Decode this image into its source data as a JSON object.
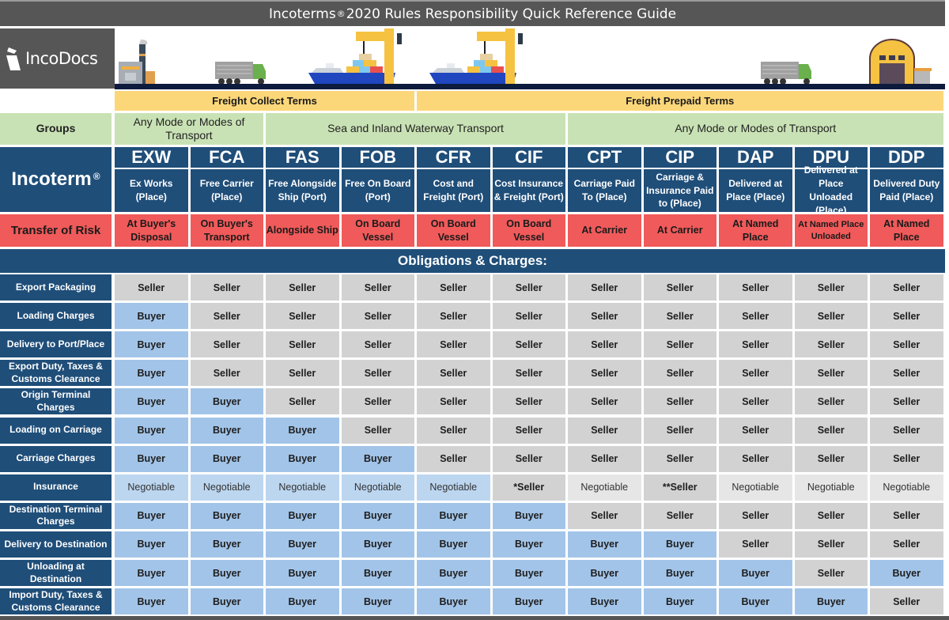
{
  "title": {
    "prefix": "Incoterms",
    "registered_mark": "®",
    "suffix": "2020 Rules Responsibility Quick Reference Guide"
  },
  "logo": {
    "text": "IncoDocs",
    "icon": "incodocs-logo-icon"
  },
  "banner_icons": [
    "factory-icon",
    "truck-icon",
    "cargo-ship-crane-icon",
    "cargo-ship-crane-icon",
    "truck-icon",
    "warehouse-icon"
  ],
  "freight_terms": [
    {
      "label": "Freight Collect Terms",
      "span": 4
    },
    {
      "label": "Freight Prepaid Terms",
      "span": 7
    }
  ],
  "groups": {
    "label": "Groups",
    "items": [
      {
        "label": "Any Mode or Modes of Transport",
        "span": 2
      },
      {
        "label": "Sea and Inland Waterway Transport",
        "span": 4
      },
      {
        "label": "Any Mode or Modes of Transport",
        "span": 5
      }
    ]
  },
  "incoterm_label": "Incoterm",
  "registered_mark": "®",
  "risk_label": "Transfer of Risk",
  "incoterms": [
    {
      "code": "EXW",
      "name": "Ex Works (Place)",
      "risk": "At Buyer's Disposal"
    },
    {
      "code": "FCA",
      "name": "Free Carrier (Place)",
      "risk": "On Buyer's Transport"
    },
    {
      "code": "FAS",
      "name": "Free Alongside Ship (Port)",
      "risk": "Alongside Ship"
    },
    {
      "code": "FOB",
      "name": "Free On Board (Port)",
      "risk": "On Board Vessel"
    },
    {
      "code": "CFR",
      "name": "Cost and Freight (Port)",
      "risk": "On Board Vessel"
    },
    {
      "code": "CIF",
      "name": "Cost Insurance & Freight (Port)",
      "risk": "On Board Vessel"
    },
    {
      "code": "CPT",
      "name": "Carriage Paid To (Place)",
      "risk": "At Carrier"
    },
    {
      "code": "CIP",
      "name": "Carriage & Insurance Paid to (Place)",
      "risk": "At Carrier"
    },
    {
      "code": "DAP",
      "name": "Delivered at Place (Place)",
      "risk": "At Named Place"
    },
    {
      "code": "DPU",
      "name": "Delivered at Place Unloaded (Place)",
      "risk": "At Named Place Unloaded"
    },
    {
      "code": "DDP",
      "name": "Delivered Duty Paid (Place)",
      "risk": "At Named Place"
    }
  ],
  "obligations_header": "Obligations & Charges:",
  "colors": {
    "navy": "#1f4e79",
    "freight_yellow": "#fcd77a",
    "group_green": "#c9e2b5",
    "risk_red": "#f05a5a",
    "seller_grey": "#d2d2d2",
    "buyer_blue": "#a2c4e8"
  },
  "obligations": [
    {
      "label": "Export Packaging",
      "values": [
        "Seller",
        "Seller",
        "Seller",
        "Seller",
        "Seller",
        "Seller",
        "Seller",
        "Seller",
        "Seller",
        "Seller",
        "Seller"
      ]
    },
    {
      "label": "Loading Charges",
      "values": [
        "Buyer",
        "Seller",
        "Seller",
        "Seller",
        "Seller",
        "Seller",
        "Seller",
        "Seller",
        "Seller",
        "Seller",
        "Seller"
      ]
    },
    {
      "label": "Delivery to Port/Place",
      "values": [
        "Buyer",
        "Seller",
        "Seller",
        "Seller",
        "Seller",
        "Seller",
        "Seller",
        "Seller",
        "Seller",
        "Seller",
        "Seller"
      ]
    },
    {
      "label": "Export Duty, Taxes & Customs Clearance",
      "values": [
        "Buyer",
        "Seller",
        "Seller",
        "Seller",
        "Seller",
        "Seller",
        "Seller",
        "Seller",
        "Seller",
        "Seller",
        "Seller"
      ]
    },
    {
      "label": "Origin Terminal Charges",
      "values": [
        "Buyer",
        "Buyer",
        "Seller",
        "Seller",
        "Seller",
        "Seller",
        "Seller",
        "Seller",
        "Seller",
        "Seller",
        "Seller"
      ]
    },
    {
      "label": "Loading on Carriage",
      "values": [
        "Buyer",
        "Buyer",
        "Buyer",
        "Seller",
        "Seller",
        "Seller",
        "Seller",
        "Seller",
        "Seller",
        "Seller",
        "Seller"
      ]
    },
    {
      "label": "Carriage Charges",
      "values": [
        "Buyer",
        "Buyer",
        "Buyer",
        "Buyer",
        "Seller",
        "Seller",
        "Seller",
        "Seller",
        "Seller",
        "Seller",
        "Seller"
      ]
    },
    {
      "label": "Insurance",
      "values": [
        "Negotiable",
        "Negotiable",
        "Negotiable",
        "Negotiable",
        "Negotiable",
        "*Seller",
        "Negotiable",
        "**Seller",
        "Negotiable",
        "Negotiable",
        "Negotiable"
      ]
    },
    {
      "label": "Destination Terminal Charges",
      "values": [
        "Buyer",
        "Buyer",
        "Buyer",
        "Buyer",
        "Buyer",
        "Buyer",
        "Seller",
        "Seller",
        "Seller",
        "Seller",
        "Seller"
      ]
    },
    {
      "label": "Delivery to Destination",
      "values": [
        "Buyer",
        "Buyer",
        "Buyer",
        "Buyer",
        "Buyer",
        "Buyer",
        "Buyer",
        "Buyer",
        "Seller",
        "Seller",
        "Seller"
      ]
    },
    {
      "label": "Unloading at Destination",
      "values": [
        "Buyer",
        "Buyer",
        "Buyer",
        "Buyer",
        "Buyer",
        "Buyer",
        "Buyer",
        "Buyer",
        "Buyer",
        "Seller",
        "Buyer"
      ]
    },
    {
      "label": "Import Duty, Taxes & Customs Clearance",
      "values": [
        "Buyer",
        "Buyer",
        "Buyer",
        "Buyer",
        "Buyer",
        "Buyer",
        "Buyer",
        "Buyer",
        "Buyer",
        "Buyer",
        "Seller"
      ]
    }
  ]
}
